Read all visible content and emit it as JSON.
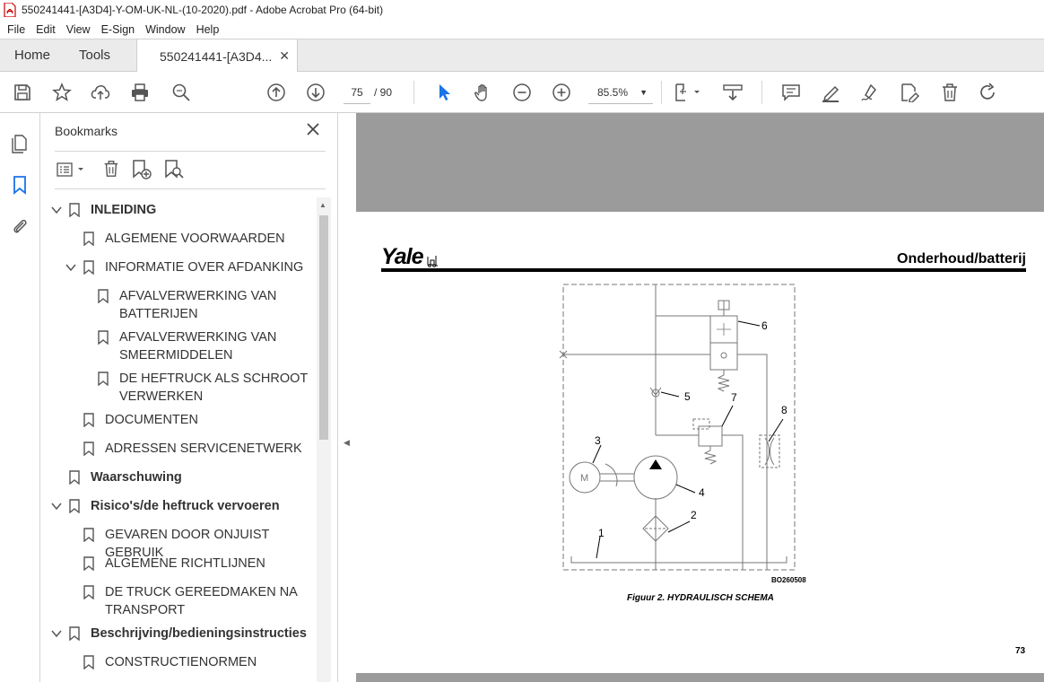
{
  "window": {
    "title": "550241441-[A3D4]-Y-OM-UK-NL-(10-2020).pdf - Adobe Acrobat Pro (64-bit)"
  },
  "menu": [
    "File",
    "Edit",
    "View",
    "E-Sign",
    "Window",
    "Help"
  ],
  "tabs": {
    "home": "Home",
    "tools": "Tools",
    "document": "550241441-[A3D4..."
  },
  "toolbar": {
    "page_current": "75",
    "page_total": "/ 90",
    "zoom": "85.5%",
    "icons": [
      "save-icon",
      "star-icon",
      "upload-icon",
      "print-icon",
      "search-icon",
      "page-up-icon",
      "page-down-icon",
      "cursor-icon",
      "hand-icon",
      "zoom-out-icon",
      "zoom-in-icon",
      "fit-page-icon",
      "scroll-mode-icon",
      "comment-icon",
      "highlight-icon",
      "sign-icon",
      "edit-pdf-icon",
      "delete-icon",
      "redo-icon"
    ]
  },
  "panel": {
    "title": "Bookmarks",
    "items": [
      {
        "label": "INLEIDING",
        "level": 0,
        "bold": true,
        "expanded": true
      },
      {
        "label": "ALGEMENE VOORWAARDEN",
        "level": 1,
        "bold": false
      },
      {
        "label": "INFORMATIE OVER AFDANKING",
        "level": 1,
        "bold": false,
        "expanded": true
      },
      {
        "label": "AFVALVERWERKING VAN\nBATTERIJEN",
        "level": 2,
        "bold": false
      },
      {
        "label": "AFVALVERWERKING VAN\nSMEERMIDDELEN",
        "level": 2,
        "bold": false
      },
      {
        "label": "DE HEFTRUCK ALS SCHROOT\nVERWERKEN",
        "level": 2,
        "bold": false
      },
      {
        "label": "DOCUMENTEN",
        "level": 1,
        "bold": false
      },
      {
        "label": "ADRESSEN SERVICENETWERK",
        "level": 1,
        "bold": false
      },
      {
        "label": "Waarschuwing",
        "level": 0,
        "bold": true
      },
      {
        "label": "Risico's/de heftruck vervoeren",
        "level": 0,
        "bold": true,
        "expanded": true
      },
      {
        "label": "GEVAREN DOOR ONJUIST GEBRUIK",
        "level": 1,
        "bold": false
      },
      {
        "label": "ALGEMENE RICHTLIJNEN",
        "level": 1,
        "bold": false
      },
      {
        "label": "DE TRUCK GEREEDMAKEN NA\nTRANSPORT",
        "level": 1,
        "bold": false
      },
      {
        "label": "Beschrijving/bedieningsinstructies",
        "level": 0,
        "bold": true,
        "expanded": true
      },
      {
        "label": "CONSTRUCTIENORMEN",
        "level": 1,
        "bold": false
      }
    ]
  },
  "document": {
    "logo": "Yale",
    "section": "Onderhoud/batterij",
    "figure_id": "BO260508",
    "caption": "Figuur 2. HYDRAULISCH SCHEMA",
    "page_number": "73",
    "callouts": [
      "1",
      "2",
      "3",
      "4",
      "5",
      "6",
      "7",
      "8"
    ],
    "motor_label": "M"
  }
}
